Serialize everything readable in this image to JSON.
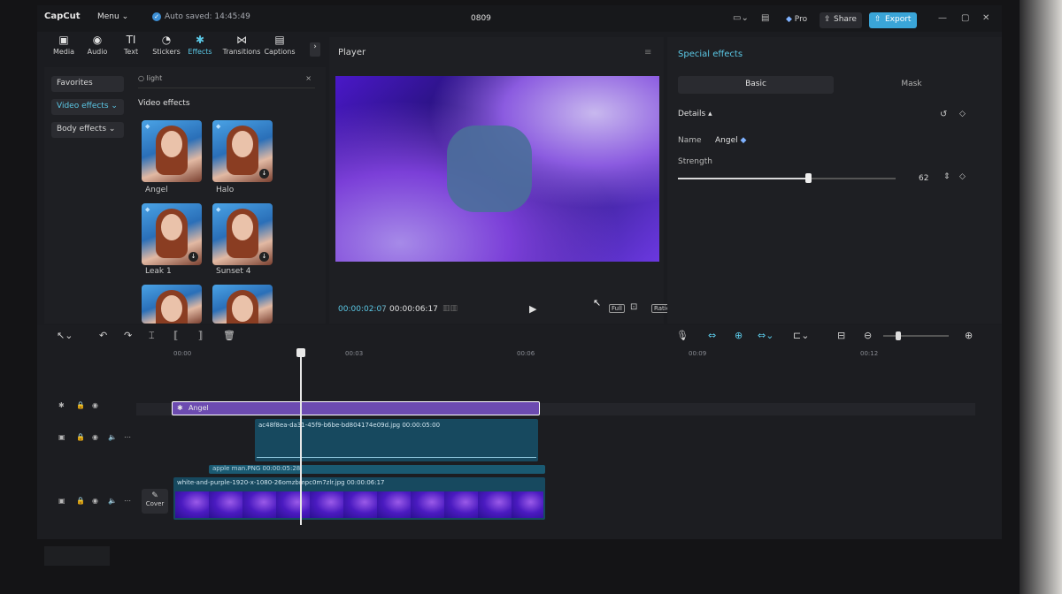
{
  "titlebar": {
    "logo": "CapCut",
    "menu": "Menu",
    "autosave": "Auto saved: 14:45:49",
    "project_title": "0809",
    "pro": "Pro",
    "share": "Share",
    "export": "Export"
  },
  "toolbar": {
    "items": [
      {
        "label": "Media",
        "icon": "media-icon"
      },
      {
        "label": "Audio",
        "icon": "audio-icon"
      },
      {
        "label": "Text",
        "icon": "text-icon"
      },
      {
        "label": "Stickers",
        "icon": "stickers-icon"
      },
      {
        "label": "Effects",
        "icon": "effects-icon"
      },
      {
        "label": "Transitions",
        "icon": "transitions-icon"
      },
      {
        "label": "Captions",
        "icon": "captions-icon"
      }
    ],
    "active": "Effects"
  },
  "left_panel": {
    "categories": [
      {
        "label": "Favorites"
      },
      {
        "label": "Video effects"
      },
      {
        "label": "Body effects"
      }
    ],
    "search_value": "light",
    "section_title": "Video effects",
    "effects": [
      {
        "label": "Angel"
      },
      {
        "label": "Halo"
      },
      {
        "label": "Leak 1"
      },
      {
        "label": "Sunset 4"
      }
    ]
  },
  "player": {
    "title": "Player",
    "current_time": "00:00:02:07",
    "separator": "/",
    "duration": "00:00:06:17",
    "full_label": "Full",
    "ratio_label": "Ratio"
  },
  "right_panel": {
    "title": "Special effects",
    "tabs": [
      "Basic",
      "Mask"
    ],
    "details": "Details",
    "name_label": "Name",
    "name_value": "Angel",
    "strength_label": "Strength",
    "strength_value": "62"
  },
  "timeline": {
    "ticks": [
      "00:00",
      "00:03",
      "00:06",
      "00:09",
      "00:12"
    ],
    "fx_clip": "Angel",
    "image_clip": "ac48f8ea-da31-45f9-b6be-bd804174e09d.jpg   00:00:05:00",
    "apple_clip": "apple man.PNG   00:00:05:28",
    "main_clip": "white-and-purple-1920-x-1080-26omzbmpc0m7zlr.jpg   00:00:06:17",
    "cover_label": "Cover"
  },
  "colors": {
    "accent": "#5bc8e6",
    "export": "#3aa5d8",
    "effect_clip": "#6c4bb0",
    "media_clip": "#17495f"
  }
}
